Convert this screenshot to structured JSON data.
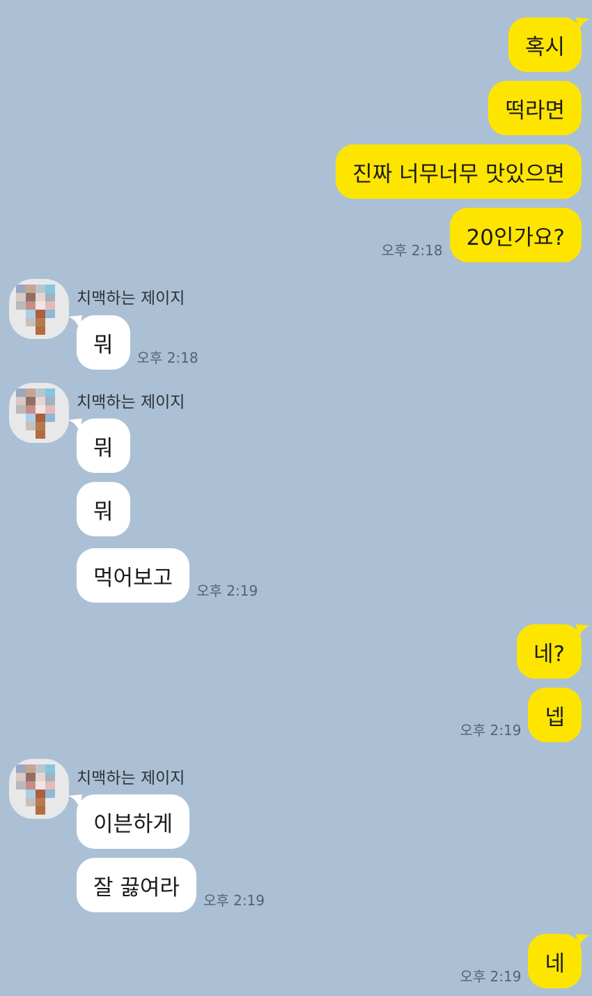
{
  "contact": {
    "name": "치맥하는 제이지"
  },
  "messages": [
    {
      "side": "sent",
      "text": "혹시"
    },
    {
      "side": "sent",
      "text": "떡라면"
    },
    {
      "side": "sent",
      "text": "진짜 너무너무 맛있으면"
    },
    {
      "side": "sent",
      "text": "20인가요?",
      "time": "오후 2:18"
    },
    {
      "side": "recv",
      "text": "뭐",
      "time": "오후 2:18"
    },
    {
      "side": "recv",
      "text": "뭐"
    },
    {
      "side": "recv",
      "text": "뭐"
    },
    {
      "side": "recv",
      "text": "먹어보고",
      "time": "오후 2:19"
    },
    {
      "side": "sent",
      "text": "네?"
    },
    {
      "side": "sent",
      "text": "넵",
      "time": "오후 2:19"
    },
    {
      "side": "recv",
      "text": "이븐하게"
    },
    {
      "side": "recv",
      "text": "잘 끓여라",
      "time": "오후 2:19"
    },
    {
      "side": "sent",
      "text": "네",
      "time": "오후 2:19"
    }
  ],
  "colors": {
    "background": "#abc0d5",
    "sent_bubble": "#fee500",
    "recv_bubble": "#ffffff"
  },
  "icons": {
    "avatar": "pixelated-avatar-icon"
  }
}
